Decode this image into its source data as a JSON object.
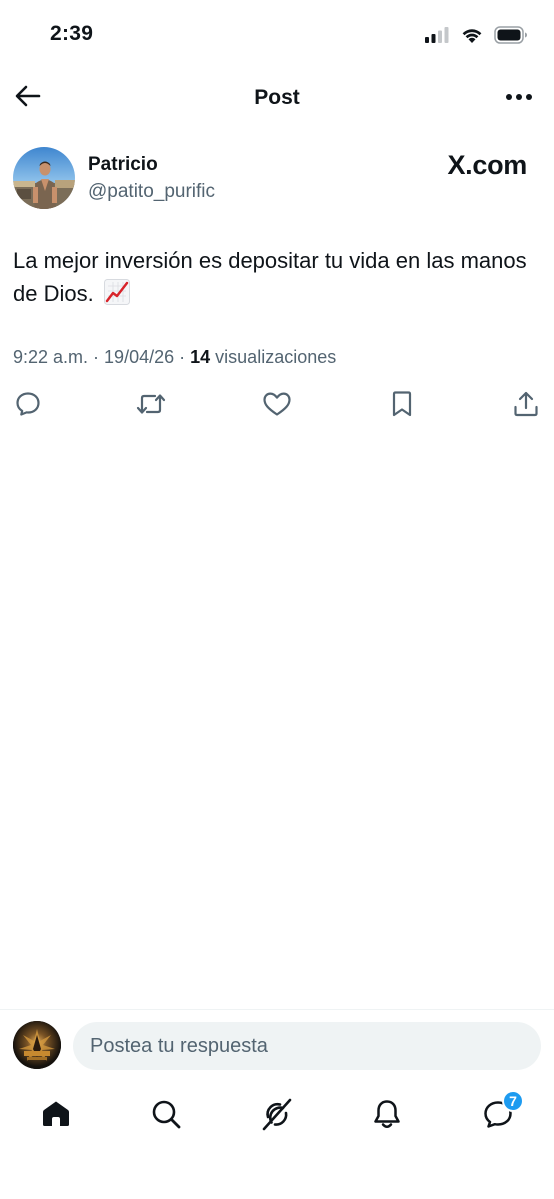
{
  "status_bar": {
    "time": "2:39",
    "icons": [
      "cellular-signal-icon",
      "wifi-icon",
      "battery-icon"
    ]
  },
  "header": {
    "title": "Post",
    "back_icon": "arrow-left-icon",
    "more_icon": "more-horizontal-icon"
  },
  "post": {
    "author_name": "Patricio",
    "author_handle": "@patito_purific",
    "source_logo": "X.com",
    "text": "La mejor inversión es depositar tu vida en las manos de Dios.",
    "emoji": "chart-increasing-emoji",
    "time": "9:22 a.m.",
    "separator": " · ",
    "date": "19/04/26",
    "views_count": "14",
    "views_label": "visualizaciones"
  },
  "actions": [
    "reply-icon",
    "retweet-icon",
    "like-icon",
    "bookmark-icon",
    "share-icon"
  ],
  "reply": {
    "placeholder": "Postea tu respuesta"
  },
  "tabbar": {
    "items": [
      "home-icon",
      "search-icon",
      "grok-icon",
      "notifications-icon",
      "messages-icon"
    ],
    "messages_badge": "7"
  },
  "colors": {
    "text": "#0f1419",
    "secondary": "#536471",
    "accent": "#1d9bf0",
    "input_bg": "#eff3f4",
    "emoji_red": "#d8232a"
  }
}
